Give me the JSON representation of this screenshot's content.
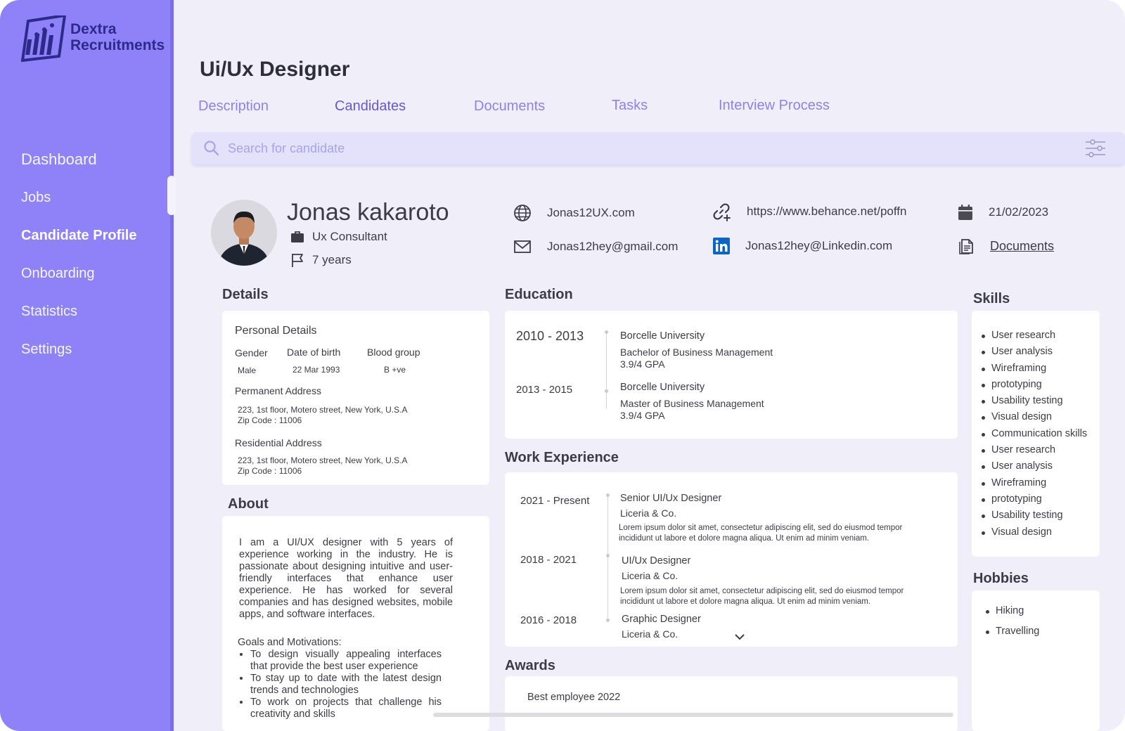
{
  "brand": {
    "line1": "Dextra",
    "line2": "Recruitments"
  },
  "sidebar": {
    "items": [
      {
        "label": "Dashboard"
      },
      {
        "label": "Jobs"
      },
      {
        "label": "Candidate Profile"
      },
      {
        "label": "Onboarding"
      },
      {
        "label": "Statistics"
      },
      {
        "label": "Settings"
      }
    ],
    "active": "Candidate Profile"
  },
  "header": {
    "title": "Ui/Ux Designer",
    "tabs": [
      {
        "label": "Description"
      },
      {
        "label": "Candidates"
      },
      {
        "label": "Documents"
      },
      {
        "label": "Tasks"
      },
      {
        "label": "Interview Process"
      }
    ],
    "active_tab": "Candidates"
  },
  "search": {
    "placeholder": "Search for candidate",
    "value": ""
  },
  "candidate": {
    "name": "Jonas kakaroto",
    "role": "Ux Consultant",
    "experience": "7 years",
    "website": "Jonas12UX.com",
    "email": "Jonas12hey@gmail.com",
    "portfolio": "https://www.behance.net/poffn",
    "linkedin": "Jonas12hey@Linkedin.com",
    "date": "21/02/2023",
    "documents_label": "Documents"
  },
  "details": {
    "section_title": "Details",
    "personal_title": "Personal Details",
    "gender_label": "Gender",
    "gender": "Male",
    "dob_label": "Date of birth",
    "dob": "22 Mar 1993",
    "blood_label": "Blood group",
    "blood": "B +ve",
    "permanent_label": "Permanent Address",
    "permanent_line1": "223, 1st floor, Motero street, New York, U.S.A",
    "permanent_line2": "Zip Code : 11006",
    "residential_label": "Residential Address",
    "residential_line1": "223, 1st floor, Motero street, New York, U.S.A",
    "residential_line2": "Zip Code : 11006"
  },
  "about": {
    "section_title": "About",
    "text": "I am a UI/UX designer with 5 years of experience working in the industry. He is passionate about designing intuitive and user-friendly interfaces that enhance user experience. He has worked for several companies and has designed websites, mobile apps, and software interfaces.",
    "goals_title": "Goals and Motivations:",
    "goals": [
      "To design visually appealing interfaces that provide the best user experience",
      "To stay up to date with the latest design trends and technologies",
      "To work on projects that challenge his creativity and skills"
    ]
  },
  "education": {
    "section_title": "Education",
    "items": [
      {
        "years": "2010 - 2013",
        "school": "Borcelle University",
        "degree": "Bachelor of Business Management",
        "gpa": "3.9/4 GPA"
      },
      {
        "years": "2013 - 2015",
        "school": "Borcelle University",
        "degree": "Master of Business Management",
        "gpa": "3.9/4 GPA"
      }
    ]
  },
  "work": {
    "section_title": "Work Experience",
    "items": [
      {
        "years": "2021 - Present",
        "title": "Senior UI/Ux Designer",
        "company": "Liceria & Co.",
        "desc": "Lorem ipsum dolor sit amet, consectetur adipiscing elit, sed do eiusmod tempor incididunt ut labore et dolore magna aliqua. Ut enim ad minim veniam."
      },
      {
        "years": "2018 - 2021",
        "title": "UI/Ux Designer",
        "company": "Liceria & Co.",
        "desc": "Lorem ipsum dolor sit amet, consectetur adipiscing elit, sed do eiusmod tempor incididunt ut labore et dolore magna aliqua. Ut enim ad minim veniam."
      },
      {
        "years": "2016 - 2018",
        "title": "Graphic Designer",
        "company": "Liceria & Co.",
        "desc": ""
      }
    ]
  },
  "awards": {
    "section_title": "Awards",
    "items": [
      "Best employee 2022"
    ]
  },
  "skills": {
    "section_title": "Skills",
    "items": [
      "User research",
      "User analysis",
      "Wireframing",
      "prototyping",
      "Usability testing",
      "Visual design",
      "Communication skills",
      "User research",
      "User analysis",
      "Wireframing",
      "prototyping",
      "Usability testing",
      "Visual design"
    ]
  },
  "hobbies": {
    "section_title": "Hobbies",
    "items": [
      "Hiking",
      "Travelling"
    ]
  },
  "colors": {
    "sidebar": "#8f82f9",
    "accent": "#6657d8",
    "tab": "#8f82e8",
    "search_bg": "#e4e1fa",
    "logo": "#2c2a8a",
    "linkedin": "#0a66c2"
  },
  "icons": [
    "search-icon",
    "filter-icon",
    "globe-icon",
    "link-icon",
    "calendar-icon",
    "mail-icon",
    "linkedin-icon",
    "document-icon",
    "briefcase-icon",
    "flag-icon",
    "chevron-down-icon"
  ]
}
